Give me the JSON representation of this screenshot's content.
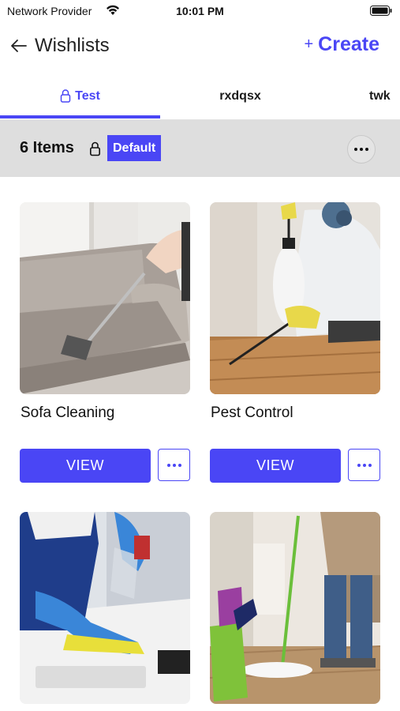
{
  "status_bar": {
    "carrier": "Network Provider",
    "time": "10:01 PM"
  },
  "header": {
    "title": "Wishlists",
    "create_plus": "+",
    "create_label": "Create"
  },
  "tabs": [
    {
      "label": "Test",
      "active": true,
      "locked": true
    },
    {
      "label": "rxdqsx",
      "active": false,
      "locked": false
    },
    {
      "label": "twk",
      "active": false,
      "locked": false
    }
  ],
  "summary": {
    "items_label": "6 Items",
    "badge": "Default"
  },
  "cards": [
    {
      "title": "Sofa Cleaning",
      "button": "VIEW"
    },
    {
      "title": "Pest Control",
      "button": "VIEW"
    },
    {
      "title": "",
      "button": ""
    },
    {
      "title": "",
      "button": ""
    }
  ],
  "colors": {
    "accent": "#4a46f5",
    "summary_bg": "#dedede",
    "tab_border": "#e2e2e2"
  },
  "icons": [
    "wifi-icon",
    "battery-icon",
    "back-arrow-icon",
    "lock-icon",
    "more-horizontal-icon"
  ]
}
